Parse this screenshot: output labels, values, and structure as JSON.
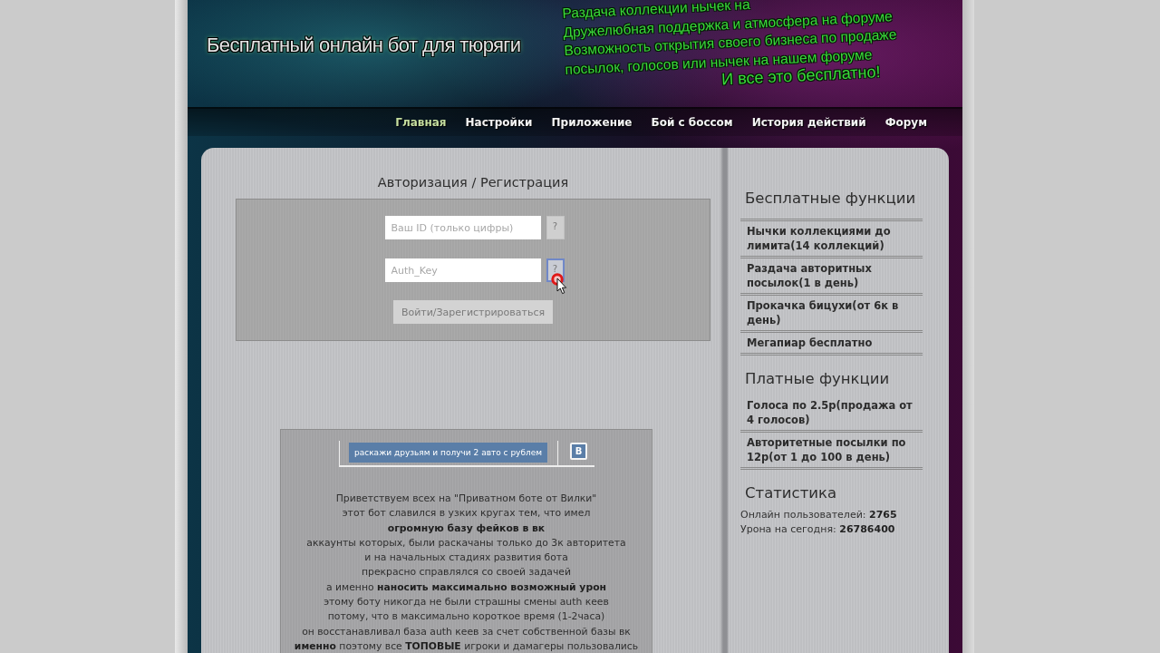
{
  "banner": {
    "tagline": "Бесплатный онлайн бот для тюряги",
    "features": [
      "Раздача коллекции нычек на",
      "Дружелюбная поддержка и атмосфера на форуме",
      "Возможность открытия своего бизнеса по продаже",
      "посылок, голосов или нычек на нашем форуме"
    ],
    "slogan": "И все это бесплатно!"
  },
  "nav": [
    {
      "label": "Главная",
      "selected": true
    },
    {
      "label": "Настройки",
      "selected": false
    },
    {
      "label": "Приложение",
      "selected": false
    },
    {
      "label": "Бой с боссом",
      "selected": false
    },
    {
      "label": "История действий",
      "selected": false
    },
    {
      "label": "Форум",
      "selected": false
    }
  ],
  "auth": {
    "title": "Авторизация / Регистрация",
    "fields": [
      {
        "placeholder": "Ваш ID (только цифры)",
        "help": {
          "label": "?",
          "hovered": false
        }
      },
      {
        "placeholder": "Auth_Key",
        "help": {
          "label": "?",
          "hovered": true
        }
      }
    ],
    "submit": "Войти/Зарегистрироваться"
  },
  "share": {
    "label": "раскажи друзьям и получи 2 авто с рублем",
    "icon_letter": "В"
  },
  "intro_lines": [
    "Приветствуем всех на \"Приватном боте от Вилки\"",
    "этот бот славился в узких кругах тем, что имел",
    "**огромную базу фейков в вк**",
    "аккаунты которых, были раскачаны только до 3к авторитета",
    "и на начальных стадиях развития бота",
    "прекрасно справлялся со своей задачей",
    "а именно **наносить максимально возможный урон**",
    "этому боту никогда не были страшны смены auth кеев",
    "потому, что в максимально короткое время (1-2часа)",
    "он восстанавливал база auth кеев за счет собственной базы вк",
    "**именно** поэтому все **ТОПОВЫЕ** игроки и дамагеры пользовались"
  ],
  "sidebar": {
    "sections": [
      {
        "title": "Бесплатные функции",
        "items": [
          "Нычки коллекциями до лимита(14 коллекций)",
          "Раздача авторитных посылок(1 в день)",
          "Прокачка бицухи(от 6к в день)",
          "Мегапиар бесплатно"
        ]
      },
      {
        "title": "Платные функции",
        "items": [
          "Голоса по 2.5р(продажа от 4 голосов)",
          "Авторитетные посылки по 12р(от 1 до 100 в день)"
        ]
      }
    ],
    "stats": {
      "title": "Статистика",
      "rows": [
        {
          "label": "Онлайн пользователей:",
          "value": "2765"
        },
        {
          "label": "Урона на сегодня:",
          "value": "26786400"
        }
      ]
    }
  }
}
